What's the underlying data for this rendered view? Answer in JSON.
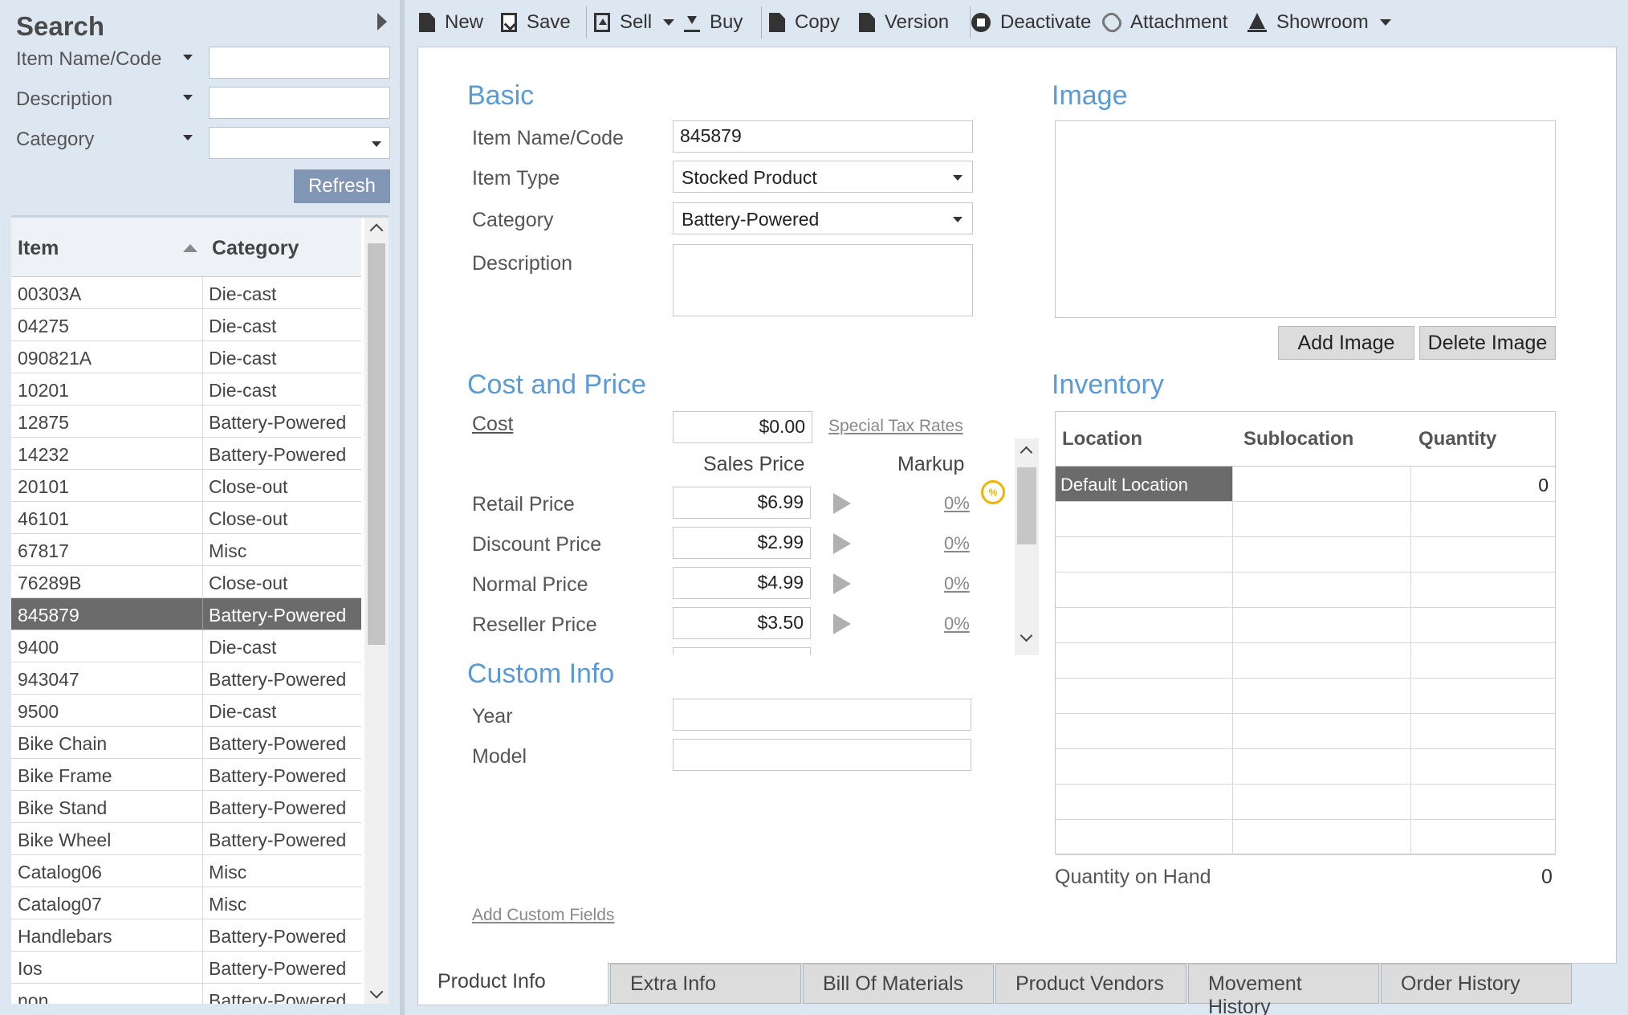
{
  "search": {
    "title": "Search",
    "fields": [
      {
        "label": "Item Name/Code",
        "value": ""
      },
      {
        "label": "Description",
        "value": ""
      },
      {
        "label": "Category",
        "value": ""
      }
    ],
    "refresh_label": "Refresh"
  },
  "grid": {
    "columns": [
      "Item",
      "Category"
    ],
    "rows": [
      {
        "item": "00303A",
        "category": "Die-cast"
      },
      {
        "item": "04275",
        "category": "Die-cast"
      },
      {
        "item": "090821A",
        "category": "Die-cast"
      },
      {
        "item": "10201",
        "category": "Die-cast"
      },
      {
        "item": "12875",
        "category": "Battery-Powered"
      },
      {
        "item": "14232",
        "category": "Battery-Powered"
      },
      {
        "item": "20101",
        "category": "Close-out"
      },
      {
        "item": "46101",
        "category": "Close-out"
      },
      {
        "item": "67817",
        "category": "Misc"
      },
      {
        "item": "76289B",
        "category": "Close-out"
      },
      {
        "item": "845879",
        "category": "Battery-Powered",
        "selected": true
      },
      {
        "item": "9400",
        "category": "Die-cast"
      },
      {
        "item": "943047",
        "category": "Battery-Powered"
      },
      {
        "item": "9500",
        "category": "Die-cast"
      },
      {
        "item": "Bike Chain",
        "category": "Battery-Powered"
      },
      {
        "item": "Bike Frame",
        "category": "Battery-Powered"
      },
      {
        "item": "Bike Stand",
        "category": "Battery-Powered"
      },
      {
        "item": "Bike Wheel",
        "category": "Battery-Powered"
      },
      {
        "item": "Catalog06",
        "category": "Misc"
      },
      {
        "item": "Catalog07",
        "category": "Misc"
      },
      {
        "item": "Handlebars",
        "category": "Battery-Powered"
      },
      {
        "item": "Ios",
        "category": "Battery-Powered"
      },
      {
        "item": "non",
        "category": "Battery-Powered"
      }
    ]
  },
  "toolbar": {
    "new": "New",
    "save": "Save",
    "sell": "Sell",
    "buy": "Buy",
    "copy": "Copy",
    "version": "Version",
    "deactivate": "Deactivate",
    "attachment": "Attachment",
    "showroom": "Showroom"
  },
  "basic": {
    "title": "Basic",
    "item_name_label": "Item Name/Code",
    "item_name_value": "845879",
    "item_type_label": "Item Type",
    "item_type_value": "Stocked Product",
    "category_label": "Category",
    "category_value": "Battery-Powered",
    "description_label": "Description",
    "description_value": ""
  },
  "cost_price": {
    "title": "Cost and Price",
    "cost_label": "Cost",
    "cost_value": "$0.00",
    "special_tax_link": "Special Tax Rates",
    "sales_price_header": "Sales Price",
    "markup_header": "Markup",
    "prices": [
      {
        "label": "Retail Price",
        "value": "$6.99",
        "markup": "0%"
      },
      {
        "label": "Discount Price",
        "value": "$2.99",
        "markup": "0%"
      },
      {
        "label": "Normal Price",
        "value": "$4.99",
        "markup": "0%"
      },
      {
        "label": "Reseller Price",
        "value": "$3.50",
        "markup": "0%"
      }
    ]
  },
  "custom_info": {
    "title": "Custom Info",
    "year_label": "Year",
    "year_value": "",
    "model_label": "Model",
    "model_value": "",
    "add_fields_link": "Add Custom Fields"
  },
  "image": {
    "title": "Image",
    "add_label": "Add Image",
    "delete_label": "Delete Image"
  },
  "inventory": {
    "title": "Inventory",
    "columns": [
      "Location",
      "Sublocation",
      "Quantity"
    ],
    "rows": [
      {
        "location": "Default Location",
        "sublocation": "",
        "quantity": "0"
      }
    ],
    "qoh_label": "Quantity on Hand",
    "qoh_value": "0"
  },
  "tabs": [
    "Product Info",
    "Extra Info",
    "Bill Of Materials",
    "Product Vendors",
    "Movement History",
    "Order History"
  ],
  "colors": {
    "accent": "#5b9bd5",
    "selected_row": "#6b6b6b",
    "refresh_button": "#8195b4"
  }
}
